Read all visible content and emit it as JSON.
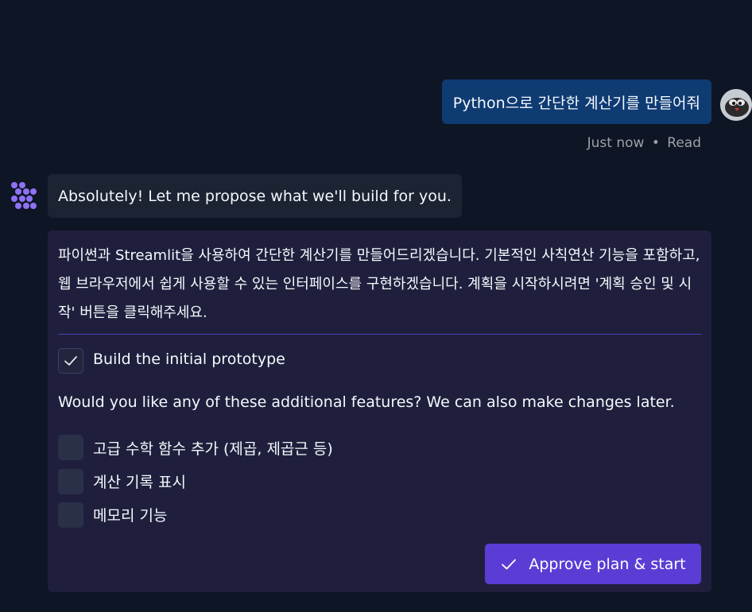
{
  "user_message": {
    "text": "Python으로 간단한 계산기를 만들어줘",
    "time": "Just now",
    "separator": "•",
    "status": "Read"
  },
  "assistant": {
    "intro": "Absolutely! Let me propose what we'll build for you.",
    "plan": {
      "description": "파이썬과 Streamlit을 사용하여 간단한 계산기를 만들어드리겠습니다. 기본적인 사칙연산 기능을 포함하고, 웹 브라우저에서 쉽게 사용할 수 있는 인터페이스를 구현하겠습니다. 계획을 시작하시려면 '계획 승인 및 시작' 버튼을 클릭해주세요.",
      "base_step": {
        "label": "Build the initial prototype",
        "checked": true
      },
      "question": "Would you like any of these additional features? We can also make changes later.",
      "features": [
        {
          "label": "고급 수학 함수 추가 (제곱, 제곱근 등)",
          "checked": false
        },
        {
          "label": "계산 기록 표시",
          "checked": false
        },
        {
          "label": "메모리 기능",
          "checked": false
        }
      ],
      "approve_label": "Approve plan & start"
    }
  },
  "colors": {
    "background": "#0e1525",
    "user_bubble": "#0f3b73",
    "agent_bubble": "#1c2333",
    "plan_card": "#1f1f3d",
    "accent": "#5b3dd6",
    "agent_icon": "#8e72f5"
  },
  "icons": {
    "agent": "agent-flower-icon",
    "check": "check-icon",
    "avatar": "user-avatar"
  }
}
